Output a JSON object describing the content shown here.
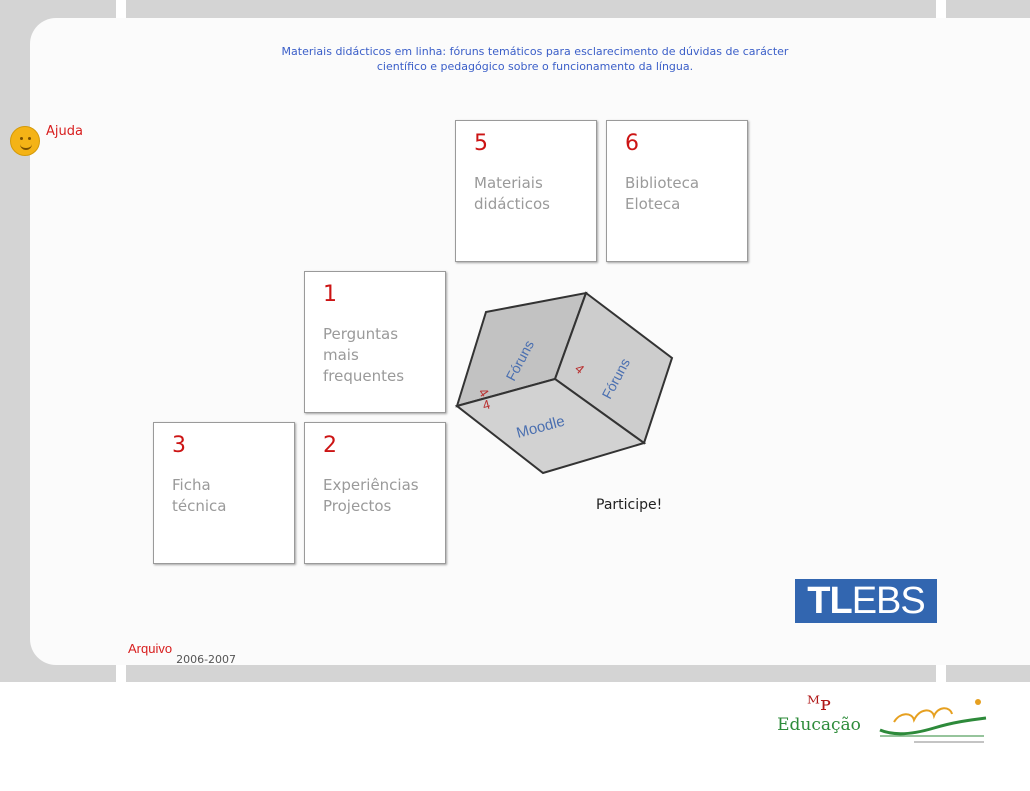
{
  "header": {
    "line1": "Materiais didácticos em linha: fóruns temáticos para esclarecimento de dúvidas de carácter",
    "line2": "científico e pedagógico sobre o funcionamento da língua."
  },
  "help": {
    "label": "Ajuda"
  },
  "cards": [
    {
      "num": "5",
      "line1": "Materiais",
      "line2": "didácticos",
      "line3": ""
    },
    {
      "num": "6",
      "line1": "Biblioteca",
      "line2": "Eloteca",
      "line3": ""
    },
    {
      "num": "1",
      "line1": "Perguntas",
      "line2": "mais",
      "line3": "frequentes"
    },
    {
      "num": "3",
      "line1": "Ficha",
      "line2": "técnica",
      "line3": ""
    },
    {
      "num": "2",
      "line1": "Experiências",
      "line2": "Projectos",
      "line3": ""
    }
  ],
  "cube": {
    "left_face": "Fóruns",
    "right_face": "Fóruns",
    "bottom_face": "Moodle",
    "face_number": "4"
  },
  "participe": "Participe!",
  "logo_tlebs": {
    "tl": "TL",
    "ebs": "EBS"
  },
  "archive": {
    "label": "Arquivo",
    "years": "2006-2007"
  },
  "logo_me": {
    "mark": "ᴹᴘ",
    "word": "Educação"
  },
  "colors": {
    "accent_red": "#cc1414",
    "header_blue": "#3a5ec8",
    "tlebs_blue": "#3266b0",
    "frame_gray": "#d4d4d4"
  }
}
